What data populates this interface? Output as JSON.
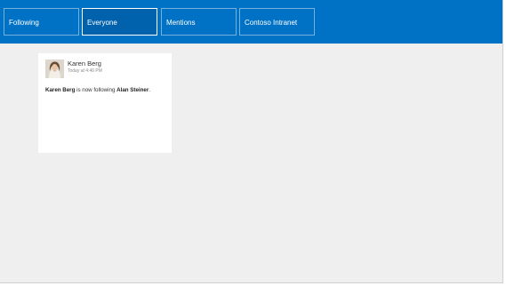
{
  "nav": {
    "tabs": [
      {
        "label": "Following",
        "active": false
      },
      {
        "label": "Everyone",
        "active": true
      },
      {
        "label": "Mentions",
        "active": false
      },
      {
        "label": "Contoso Intranet",
        "active": false
      }
    ]
  },
  "feed": {
    "posts": [
      {
        "author": "Karen Berg",
        "time": "Today at 4:40 PM",
        "avatar_icon": "user-photo-icon",
        "actor": "Karen Berg",
        "verb_text": " is now following ",
        "target": "Alan Steiner",
        "end": "."
      }
    ]
  },
  "colors": {
    "accent": "#0072c6",
    "active_tab": "#0062ad",
    "background": "#efefef",
    "card": "#ffffff"
  }
}
